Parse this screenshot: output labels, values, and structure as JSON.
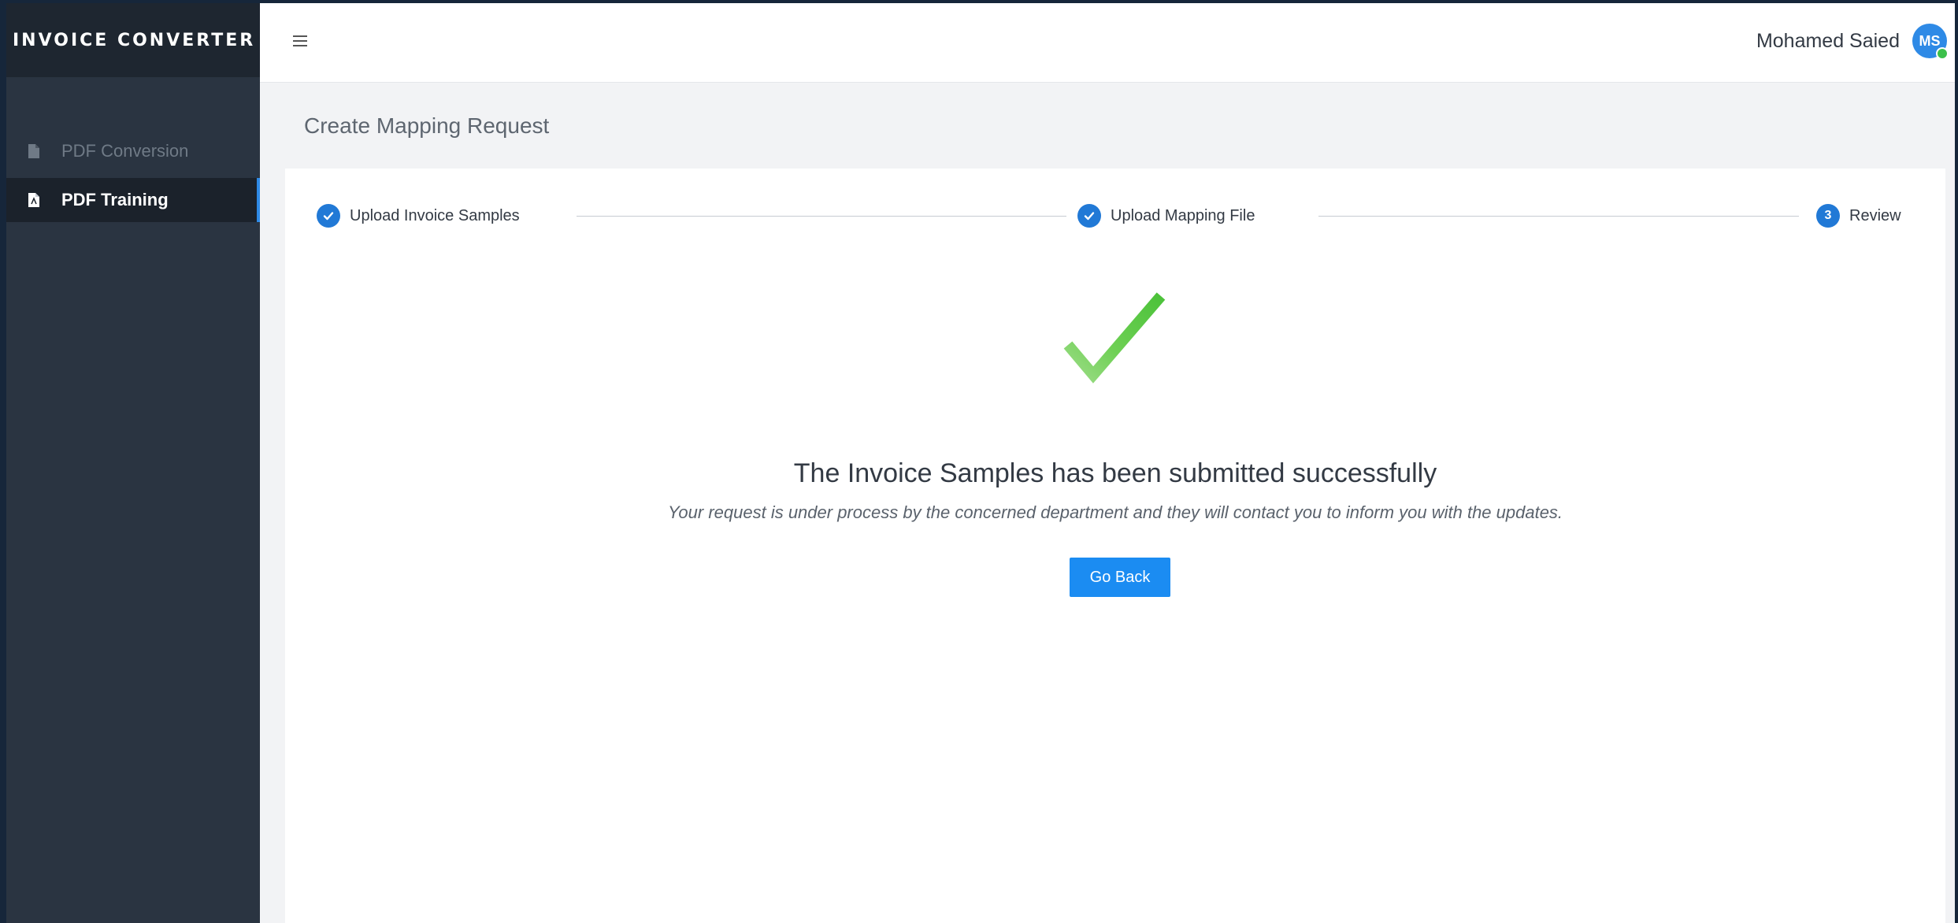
{
  "app": {
    "title": "INVOICE CONVERTER"
  },
  "sidebar": {
    "items": [
      {
        "label": "PDF Conversion",
        "icon": "pdf-file-icon",
        "active": false
      },
      {
        "label": "PDF Training",
        "icon": "pdf-file-icon",
        "active": true
      }
    ]
  },
  "header": {
    "menu_icon": "hamburger-icon",
    "user_name": "Mohamed Saied",
    "avatar_initials": "MS",
    "status": "online"
  },
  "page": {
    "title": "Create Mapping Request"
  },
  "stepper": {
    "steps": [
      {
        "label": "Upload Invoice Samples",
        "state": "completed",
        "marker": "check-icon"
      },
      {
        "label": "Upload Mapping File",
        "state": "completed",
        "marker": "check-icon"
      },
      {
        "label": "Review",
        "state": "current",
        "number": "3"
      }
    ]
  },
  "result": {
    "icon": "checkmark-icon",
    "title": "The Invoice Samples has been submitted successfully",
    "message": "Your request is under process by the concerned department and they will contact you to inform you with the updates.",
    "button_label": "Go Back"
  },
  "colors": {
    "accent": "#2179d6",
    "button": "#1b8cf2",
    "success": "#5cc84a",
    "sidebar_bg": "#2a3441",
    "brand_bg": "#1e2630"
  }
}
